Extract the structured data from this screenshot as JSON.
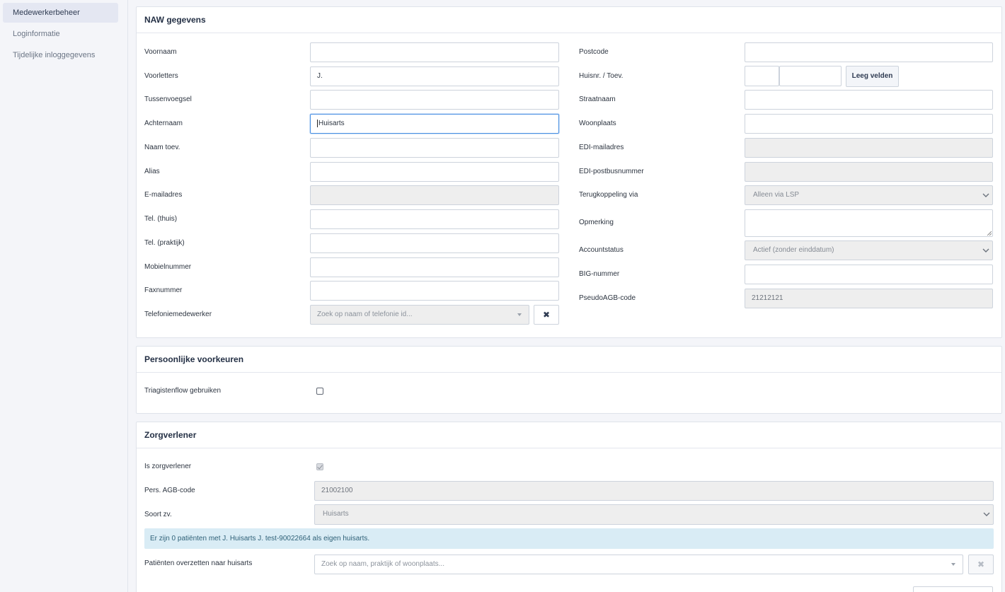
{
  "sidebar": {
    "items": [
      {
        "label": "Medewerkerbeheer",
        "active": true
      },
      {
        "label": "Loginformatie",
        "active": false
      },
      {
        "label": "Tijdelijke inloggegevens",
        "active": false
      }
    ]
  },
  "naw": {
    "title": "NAW gegevens",
    "left": {
      "voornaam_label": "Voornaam",
      "voorletters_label": "Voorletters",
      "voorletters_value": "J.",
      "tussenvoegsel_label": "Tussenvoegsel",
      "achternaam_label": "Achternaam",
      "achternaam_value": "Huisarts",
      "naam_toev_label": "Naam toev.",
      "alias_label": "Alias",
      "email_label": "E-mailadres",
      "tel_thuis_label": "Tel. (thuis)",
      "tel_praktijk_label": "Tel. (praktijk)",
      "mobiel_label": "Mobielnummer",
      "fax_label": "Faxnummer",
      "telefonie_label": "Telefoniemedewerker",
      "telefonie_placeholder": "Zoek op naam of telefonie id...",
      "clear_icon": "✖"
    },
    "right": {
      "postcode_label": "Postcode",
      "huisnr_label": "Huisnr. / Toev.",
      "leeg_button": "Leeg velden",
      "straat_label": "Straatnaam",
      "woonplaats_label": "Woonplaats",
      "edi_mail_label": "EDI-mailadres",
      "edi_postbus_label": "EDI-postbusnummer",
      "terug_label": "Terugkoppeling via",
      "terug_value": "Alleen via LSP",
      "opmerking_label": "Opmerking",
      "accountstatus_label": "Accountstatus",
      "accountstatus_value": "Actief (zonder einddatum)",
      "big_label": "BIG-nummer",
      "pseudo_agb_label": "PseudoAGB-code",
      "pseudo_agb_value": "21212121"
    }
  },
  "voorkeuren": {
    "title": "Persoonlijke voorkeuren",
    "triage_label": "Triagistenflow gebruiken"
  },
  "zorgverlener": {
    "title": "Zorgverlener",
    "is_zorg_label": "Is zorgverlener",
    "agb_label": "Pers. AGB-code",
    "agb_value": "21002100",
    "soort_label": "Soort zv.",
    "soort_value": "Huisarts",
    "info_text": "Er zijn 0 patiënten met J. Huisarts J. test-90022664 als eigen huisarts.",
    "overzetten_label": "Patiënten overzetten naar huisarts",
    "overzetten_placeholder": "Zoek op naam, praktijk of woonplaats...",
    "clear_icon": "✖"
  },
  "colors": {
    "accent_focus": "#4a90e2",
    "info_bg": "#d9ecf5",
    "info_text": "#2e6077"
  }
}
